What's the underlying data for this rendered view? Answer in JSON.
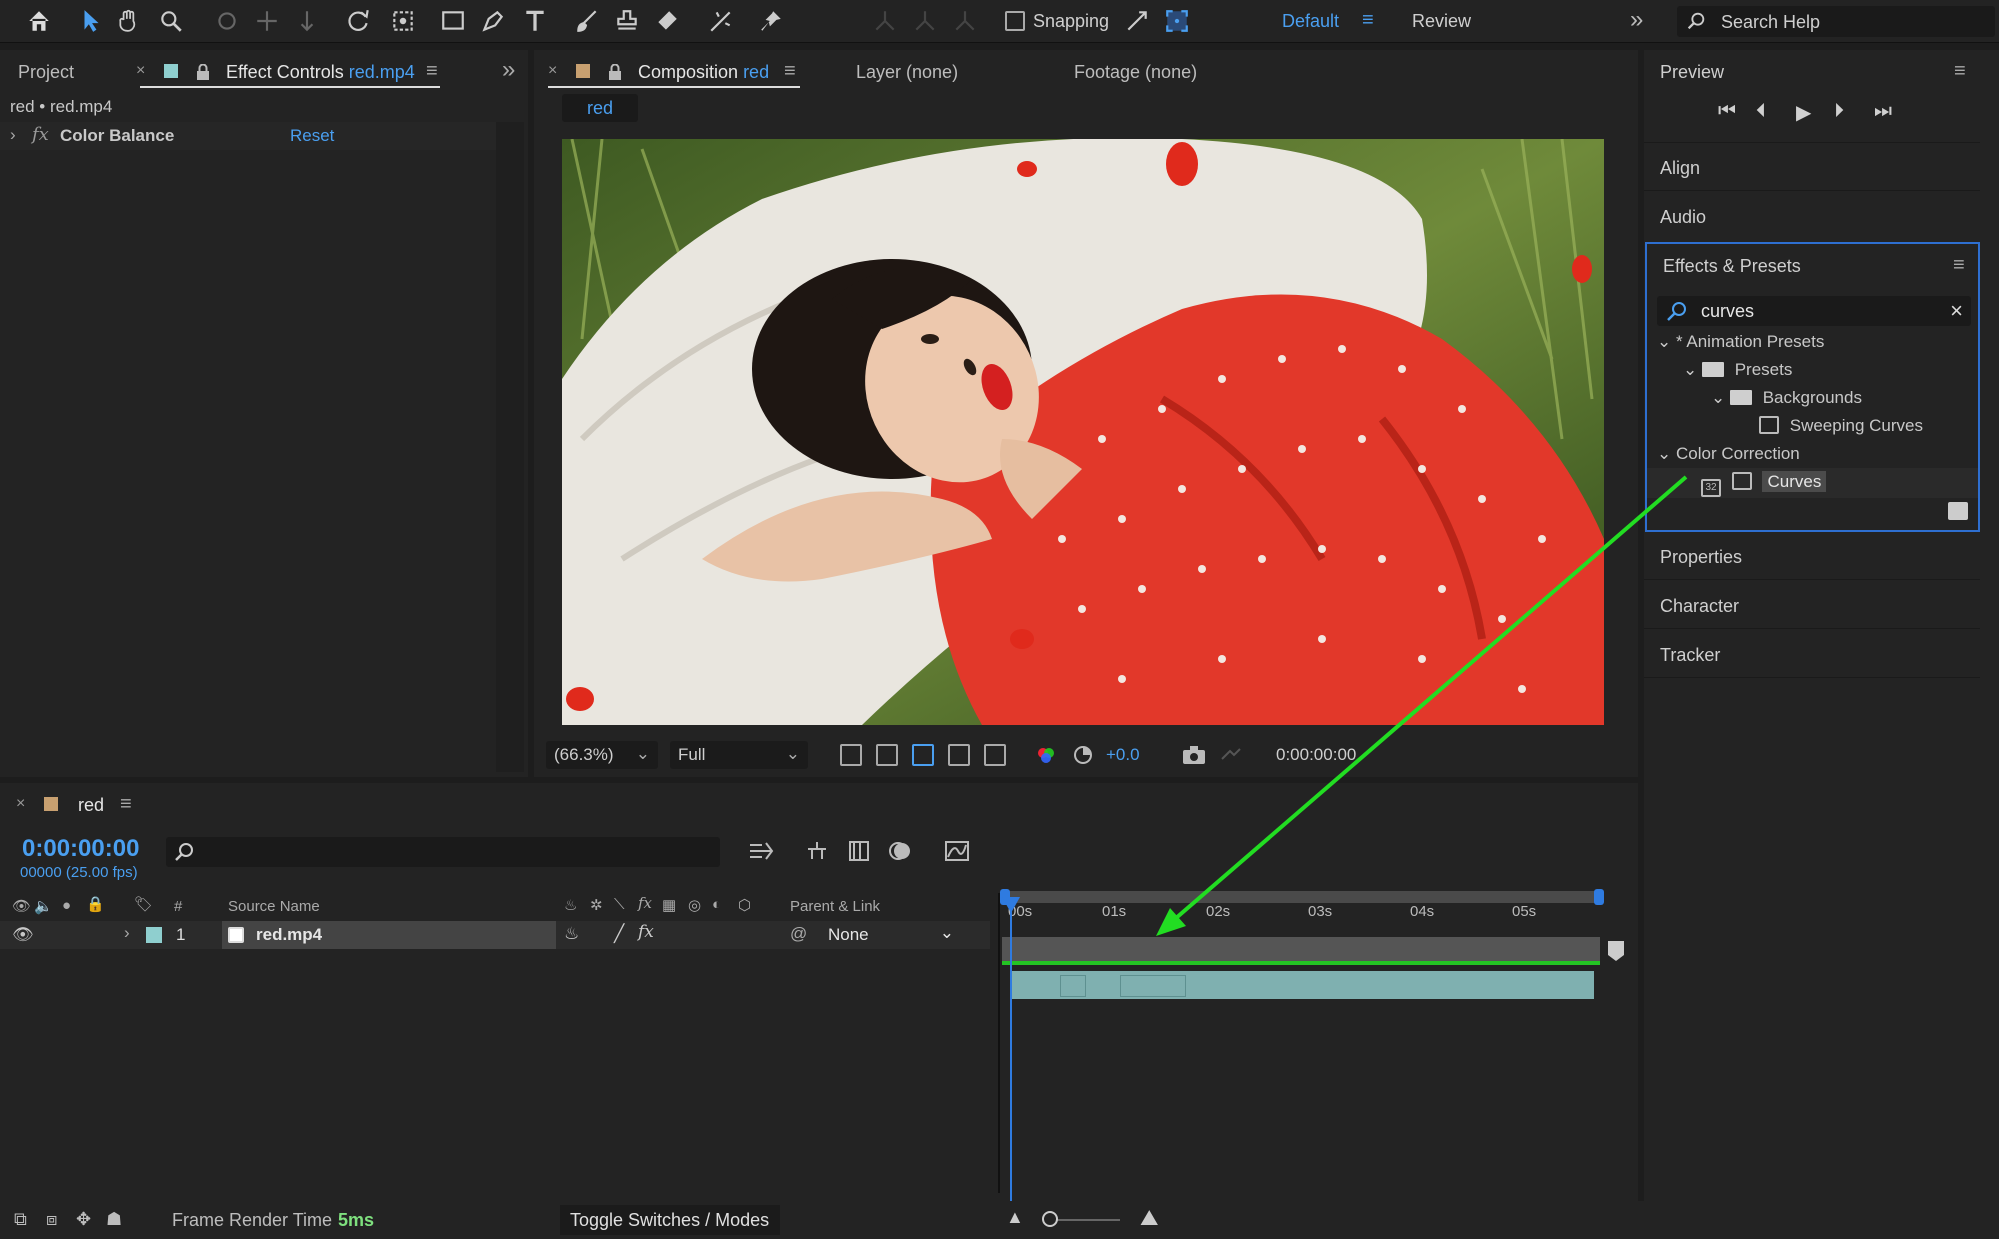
{
  "toolbar": {
    "snapping_label": "Snapping",
    "workspace_default": "Default",
    "workspace_review": "Review",
    "search_help_placeholder": "Search Help"
  },
  "effect_controls": {
    "project_tab": "Project",
    "tab_title": "Effect Controls",
    "tab_file": "red.mp4",
    "subtitle": "red • red.mp4",
    "effect_name": "Color Balance",
    "reset_label": "Reset"
  },
  "composition": {
    "tab_title": "Composition",
    "tab_name": "red",
    "layer_tab": "Layer (none)",
    "footage_tab": "Footage (none)",
    "comp_pill": "red",
    "zoom": "(66.3%)",
    "resolution": "Full",
    "exposure": "+0.0",
    "timecode": "0:00:00:00"
  },
  "right_panel": {
    "preview": "Preview",
    "align": "Align",
    "audio": "Audio",
    "effects_presets": "Effects & Presets",
    "search_value": "curves",
    "tree": {
      "animation_presets": "* Animation Presets",
      "presets": "Presets",
      "backgrounds": "Backgrounds",
      "sweeping_curves": "Sweeping Curves",
      "color_correction": "Color Correction",
      "curves": "Curves"
    },
    "properties": "Properties",
    "character": "Character",
    "tracker": "Tracker"
  },
  "timeline": {
    "comp_name": "red",
    "current_time": "0:00:00:00",
    "frames_fps": "00000 (25.00 fps)",
    "col_hash": "#",
    "col_source": "Source Name",
    "col_parent": "Parent & Link",
    "layer_index": "1",
    "layer_name": "red.mp4",
    "layer_parent": "None",
    "ruler_ticks": [
      "00s",
      "01s",
      "02s",
      "03s",
      "04s",
      "05s"
    ]
  },
  "status": {
    "frame_render_label": "Frame Render Time",
    "frame_render_value": "5ms",
    "toggle_label": "Toggle Switches / Modes"
  },
  "colors": {
    "accent_blue": "#4a9ff0",
    "annotation_arrow": "#22dd22",
    "label_teal": "#8fcfcf"
  }
}
